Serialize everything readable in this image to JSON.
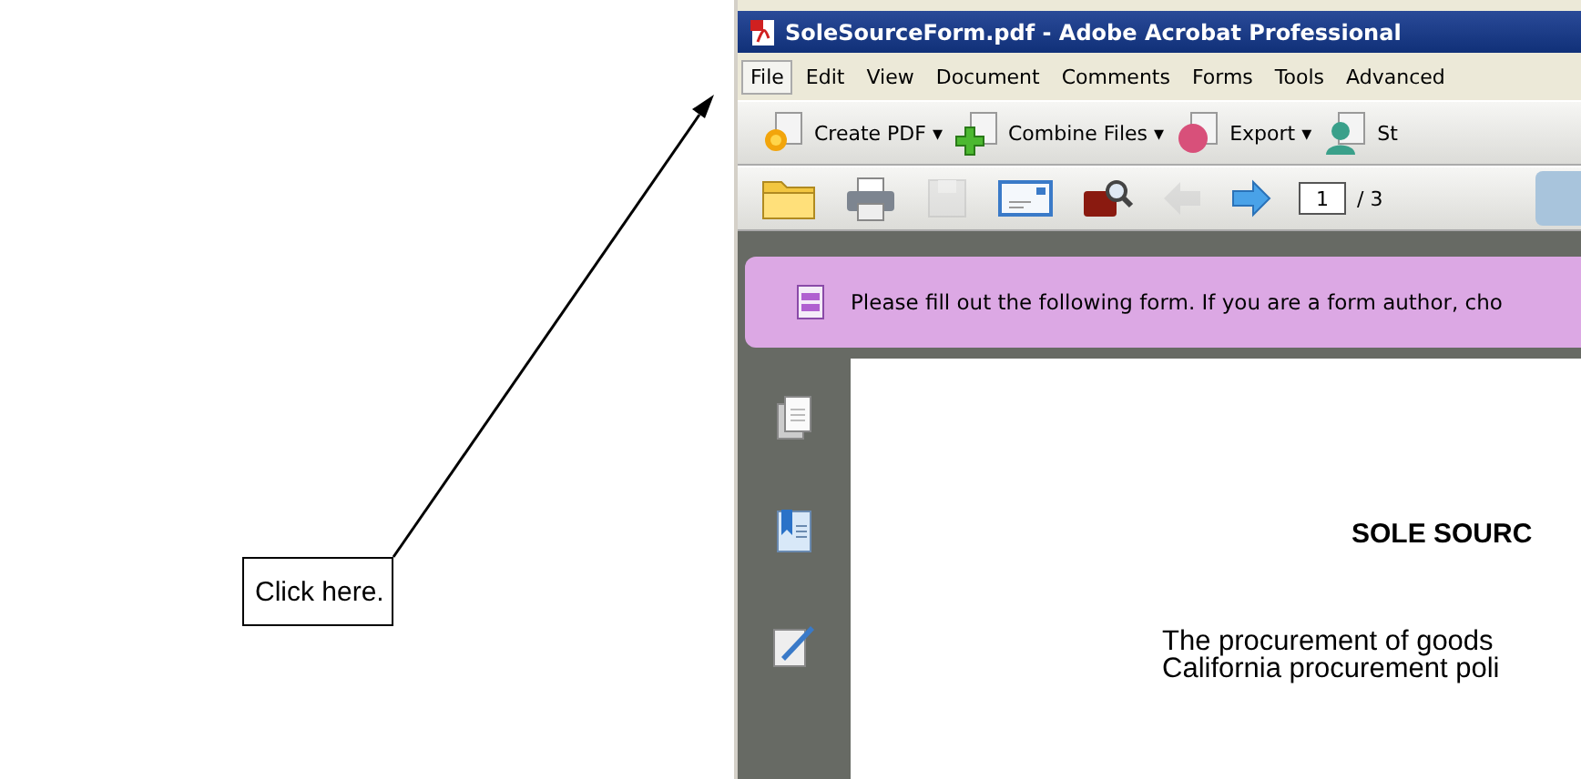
{
  "annotation": {
    "callout": "Click here."
  },
  "window": {
    "title": "SoleSourceForm.pdf - Adobe Acrobat Professional"
  },
  "menu": [
    {
      "label": "File",
      "selected": true
    },
    {
      "label": "Edit",
      "selected": false
    },
    {
      "label": "View",
      "selected": false
    },
    {
      "label": "Document",
      "selected": false
    },
    {
      "label": "Comments",
      "selected": false
    },
    {
      "label": "Forms",
      "selected": false
    },
    {
      "label": "Tools",
      "selected": false
    },
    {
      "label": "Advanced",
      "selected": false
    }
  ],
  "tasks_toolbar": [
    {
      "kind": "create",
      "label": "Create PDF ▾"
    },
    {
      "kind": "combine",
      "label": "Combine Files ▾"
    },
    {
      "kind": "export",
      "label": "Export ▾"
    },
    {
      "kind": "person",
      "label": "St"
    }
  ],
  "file_toolbar": {
    "buttons": [
      {
        "kind": "open",
        "disabled": false
      },
      {
        "kind": "print",
        "disabled": false
      },
      {
        "kind": "save",
        "disabled": true
      },
      {
        "kind": "email",
        "disabled": false
      },
      {
        "kind": "bridge",
        "disabled": false
      },
      {
        "kind": "back",
        "disabled": true
      },
      {
        "kind": "forward",
        "disabled": false
      }
    ],
    "page_field": "1",
    "page_total": "/ 3"
  },
  "form_bar": {
    "message": "Please fill out the following form. If you are a form author, cho"
  },
  "sidebar": [
    {
      "kind": "pages"
    },
    {
      "kind": "bookmarks"
    },
    {
      "kind": "signatures"
    }
  ],
  "document": {
    "heading": "SOLE SOURC",
    "lines": [
      "The procurement of goods",
      "California procurement poli"
    ]
  }
}
